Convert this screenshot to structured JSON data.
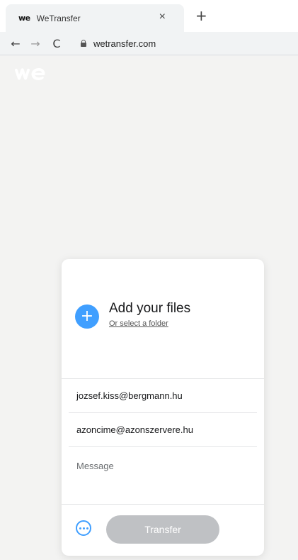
{
  "browser": {
    "tab": {
      "favicon": "we",
      "title": "WeTransfer",
      "close": "×"
    },
    "new_tab": "+",
    "nav": {
      "back": "←",
      "forward": "→",
      "reload": "C"
    },
    "url": "wetransfer.com"
  },
  "uploader": {
    "add_button": "+",
    "add_title": "Add your files",
    "select_folder": "Or select a folder",
    "email_to": "jozsef.kiss@bergmann.hu",
    "email_from": "azoncime@azonszervere.hu",
    "message_placeholder": "Message",
    "transfer_label": "Transfer"
  },
  "colors": {
    "accent": "#409fff",
    "page_bg": "#f3f3f2",
    "transfer_disabled": "#bfc1c4"
  },
  "icons": {
    "logo": "wetransfer-logo",
    "lock": "lock-icon",
    "more": "more-options-icon"
  }
}
